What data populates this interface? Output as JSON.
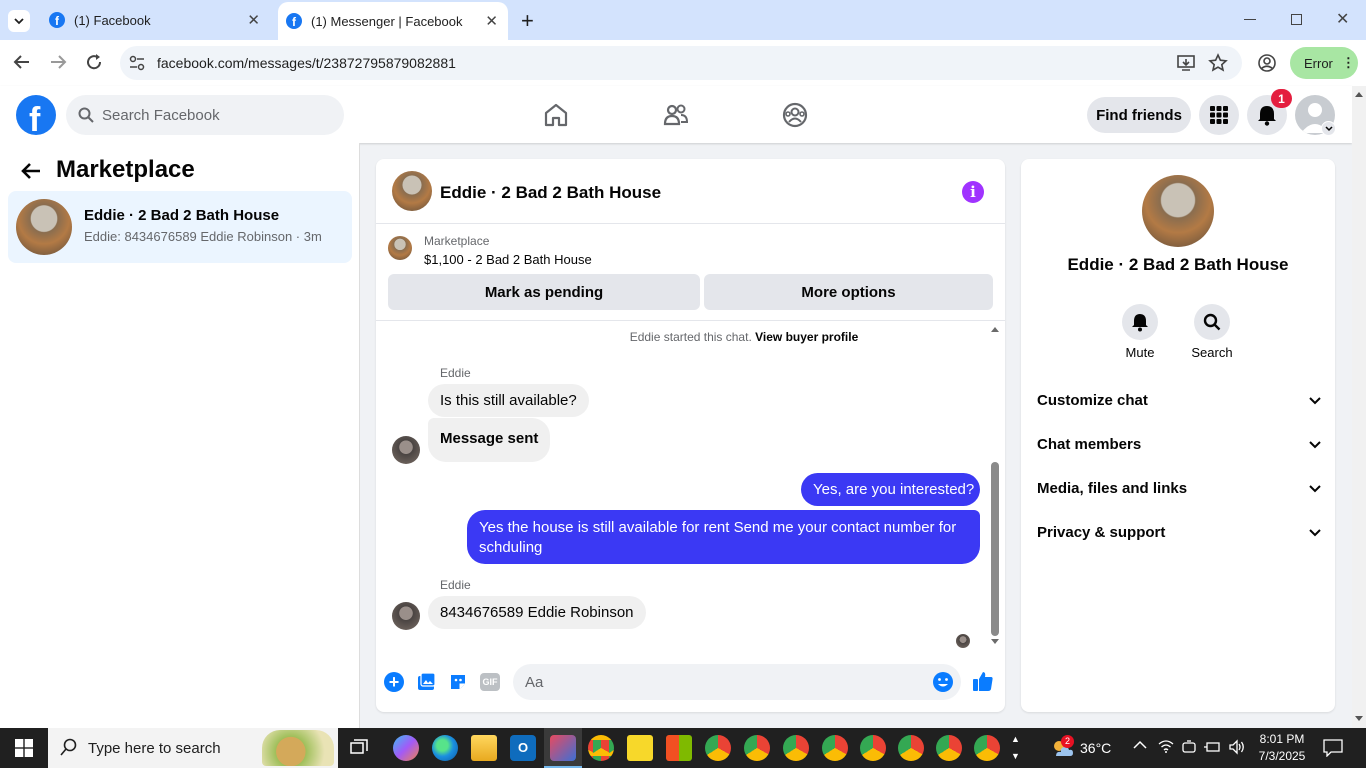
{
  "browser": {
    "tabs": [
      {
        "title": "(1) Facebook"
      },
      {
        "title": "(1) Messenger | Facebook"
      }
    ],
    "url": "facebook.com/messages/t/23872795879082881",
    "profile_button": "Error"
  },
  "fb_header": {
    "search_placeholder": "Search Facebook",
    "find_friends": "Find friends",
    "notification_count": "1",
    "logo_letter": "f"
  },
  "left_panel": {
    "title": "Marketplace",
    "conversations": [
      {
        "name": "Eddie · 2 Bad 2 Bath House",
        "preview": "Eddie: 8434676589 Eddie Robinson · 3m"
      }
    ]
  },
  "chat": {
    "title": "Eddie · 2 Bad 2 Bath House",
    "listing": {
      "label": "Marketplace",
      "price_title": "$1,100 - 2 Bad 2 Bath House"
    },
    "buttons": {
      "mark_pending": "Mark as pending",
      "more_options": "More options"
    },
    "started_text": "Eddie started this chat.",
    "view_buyer_profile": "View buyer profile",
    "messages": [
      {
        "sender": "Eddie",
        "text": "Is this still available?"
      },
      {
        "text": "Message sent"
      },
      {
        "text": "Yes, are you interested?"
      },
      {
        "text": "Yes the house is still available for rent Send me your contact number for schduling"
      },
      {
        "sender": "Eddie",
        "text": "8434676589 Eddie Robinson"
      }
    ],
    "input_placeholder": "Aa"
  },
  "right_panel": {
    "name": "Eddie · 2 Bad 2 Bath House",
    "actions": [
      {
        "label": "Mute"
      },
      {
        "label": "Search"
      }
    ],
    "sections": [
      {
        "label": "Customize chat"
      },
      {
        "label": "Chat members"
      },
      {
        "label": "Media, files and links"
      },
      {
        "label": "Privacy & support"
      }
    ]
  },
  "taskbar": {
    "search_placeholder": "Type here to search",
    "temperature": "36°C",
    "weather_badge": "2",
    "time": "8:01 PM",
    "date": "7/3/2025"
  },
  "colors": {
    "fb_blue": "#1877f2",
    "outgoing_bubble": "#3b39f4",
    "messenger_purple": "#a033ff",
    "notif_red": "#e41e3f"
  }
}
